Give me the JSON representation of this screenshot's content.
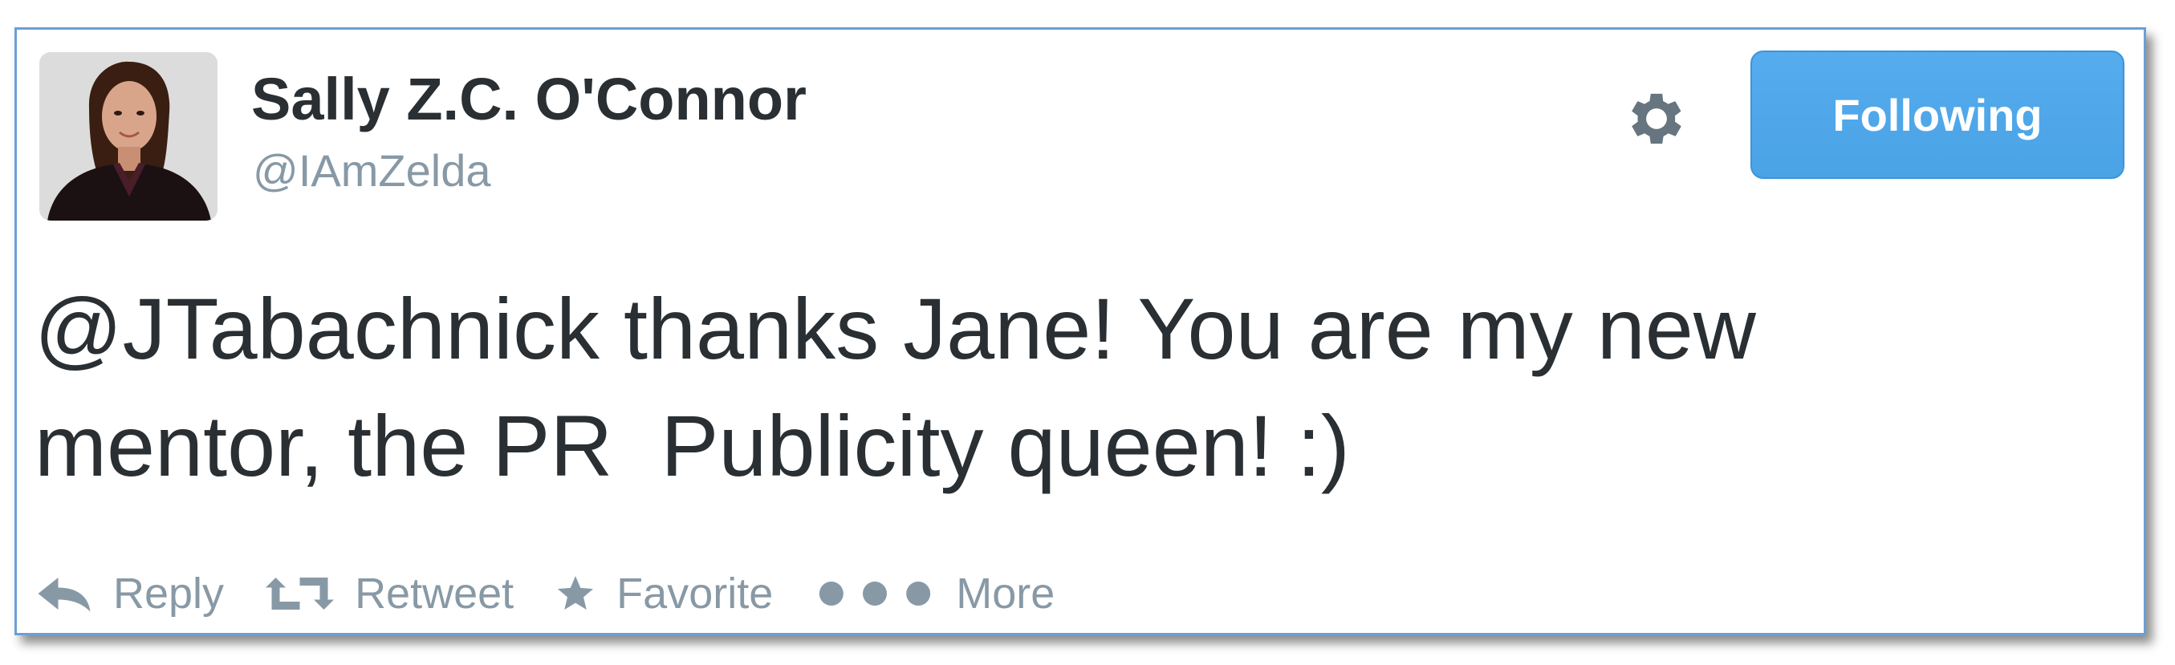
{
  "tweet": {
    "author_name": "Sally Z.C. O'Connor",
    "author_handle": "@IAmZelda",
    "text_line1": "@JTabachnick thanks Jane! You are my new",
    "text_line2": "mentor, the PR  Publicity queen! :)",
    "follow_label": "Following"
  },
  "actions": {
    "reply_label": "Reply",
    "retweet_label": "Retweet",
    "favorite_label": "Favorite",
    "more_label": "More"
  },
  "colors": {
    "follow_button": "#55acee",
    "action_gray": "#8899a6",
    "text": "#292f33",
    "card_border": "#6a9fd6"
  },
  "icons": {
    "settings": "gear-icon",
    "reply": "reply-icon",
    "retweet": "retweet-icon",
    "favorite": "star-icon",
    "more": "ellipsis-icon"
  }
}
